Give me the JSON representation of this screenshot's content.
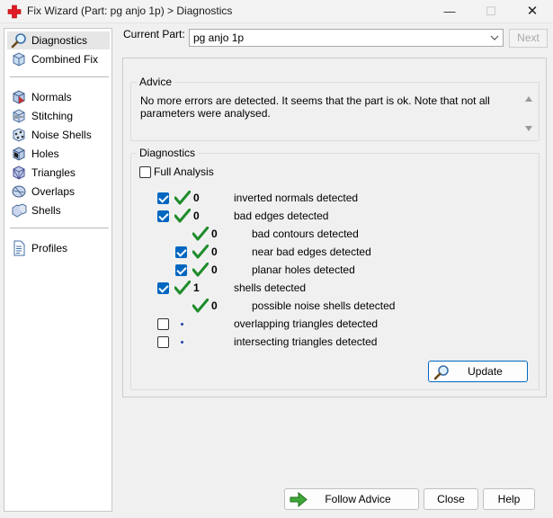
{
  "window": {
    "title": "Fix Wizard (Part: pg anjo 1p) > Diagnostics",
    "minimize_label": "—",
    "maximize_label": "☐",
    "close_label": "✕"
  },
  "sidebar": {
    "items": [
      {
        "label": "Diagnostics",
        "icon": "magnifier-icon",
        "selected": true
      },
      {
        "label": "Combined Fix",
        "icon": "cube-icon",
        "selected": false
      },
      {
        "label": "Normals",
        "icon": "normals-cube-icon",
        "selected": false
      },
      {
        "label": "Stitching",
        "icon": "stitching-cube-icon",
        "selected": false
      },
      {
        "label": "Noise Shells",
        "icon": "noise-shells-icon",
        "selected": false
      },
      {
        "label": "Holes",
        "icon": "holes-cube-icon",
        "selected": false
      },
      {
        "label": "Triangles",
        "icon": "triangles-cube-icon",
        "selected": false
      },
      {
        "label": "Overlaps",
        "icon": "overlaps-icon",
        "selected": false
      },
      {
        "label": "Shells",
        "icon": "shells-icon",
        "selected": false
      },
      {
        "label": "Profiles",
        "icon": "document-icon",
        "selected": false
      }
    ]
  },
  "current_part": {
    "label": "Current Part:",
    "value": "pg anjo 1p",
    "next_label": "Next"
  },
  "advice": {
    "title": "Advice",
    "text": "No more errors are detected. It seems that the part is ok. Note that not all parameters were analysed."
  },
  "diagnostics": {
    "title": "Diagnostics",
    "full_analysis_label": "Full Analysis",
    "full_analysis_checked": false,
    "rows": [
      {
        "checkbox": true,
        "checked": true,
        "status": "tick",
        "count": "0",
        "label": "inverted normals detected",
        "indent": 0
      },
      {
        "checkbox": true,
        "checked": true,
        "status": "tick",
        "count": "0",
        "label": "bad edges detected",
        "indent": 0
      },
      {
        "checkbox": false,
        "checked": false,
        "status": "tick",
        "count": "0",
        "label": "bad contours detected",
        "indent": 1
      },
      {
        "checkbox": true,
        "checked": true,
        "status": "tick",
        "count": "0",
        "label": "near bad edges detected",
        "indent": 1
      },
      {
        "checkbox": true,
        "checked": true,
        "status": "tick",
        "count": "0",
        "label": "planar holes detected",
        "indent": 1
      },
      {
        "checkbox": true,
        "checked": true,
        "status": "tick",
        "count": "1",
        "label": "shells detected",
        "indent": 0
      },
      {
        "checkbox": false,
        "checked": false,
        "status": "tick",
        "count": "0",
        "label": "possible noise shells detected",
        "indent": 1
      },
      {
        "checkbox": true,
        "checked": false,
        "status": "dot",
        "count": "",
        "label": "overlapping triangles detected",
        "indent": 0
      },
      {
        "checkbox": true,
        "checked": false,
        "status": "dot",
        "count": "",
        "label": "intersecting triangles detected",
        "indent": 0
      }
    ],
    "update_label": "Update"
  },
  "footer": {
    "follow_advice_label": "Follow Advice",
    "close_label": "Close",
    "help_label": "Help"
  },
  "colors": {
    "accent": "#0067c0",
    "tick_green": "#1e8c2a",
    "dot_blue": "#1f3fa8"
  }
}
